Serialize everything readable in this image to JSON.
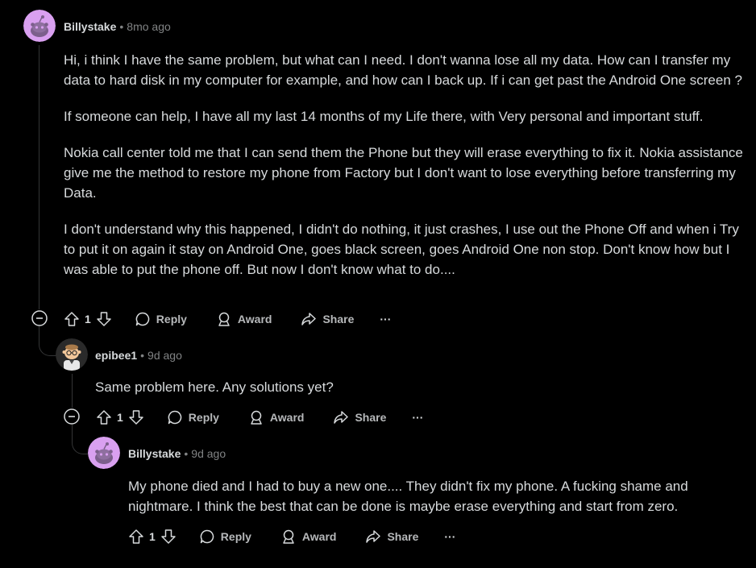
{
  "comments": [
    {
      "username": "Billystake",
      "sep": "•",
      "time": "8mo ago",
      "paragraphs": [
        "Hi, i think I have the same problem, but what can I need. I don't wanna lose all my data. How can I transfer my data to hard disk in my computer for example, and how can I back up. If i can get past the Android One screen ?",
        "If someone can help, I have all my last 14 months of my Life there, with Very personal and important stuff.",
        "Nokia call center told me that I can send them the Phone but they will erase everything to fix it. Nokia assistance give me the method to restore my phone from Factory but I don't want to lose everything before transferring my Data.",
        "I don't understand why this happened, I didn't do nothing, it just crashes, I use out the Phone Off and when i Try to put it on again it stay on Android One, goes black screen, goes Android One non stop. Don't know how but I was able to put the phone off. But now I don't know what to do...."
      ],
      "votes": "1"
    },
    {
      "username": "epibee1",
      "sep": "•",
      "time": "9d ago",
      "paragraphs": [
        "Same problem here. Any solutions yet?"
      ],
      "votes": "1"
    },
    {
      "username": "Billystake",
      "sep": "•",
      "time": "9d ago",
      "paragraphs": [
        "My phone died and I had to buy a new one.... They didn't fix my phone. A fucking shame and nightmare. I think the best that can be done is maybe erase everything and start from zero."
      ],
      "votes": "1"
    }
  ],
  "actions": {
    "reply": "Reply",
    "award": "Award",
    "share": "Share",
    "more": "···"
  },
  "colors": {
    "background": "#000000",
    "avatar_pink": "#d9a0f0",
    "text": "#d7dadc",
    "muted": "#818384"
  }
}
